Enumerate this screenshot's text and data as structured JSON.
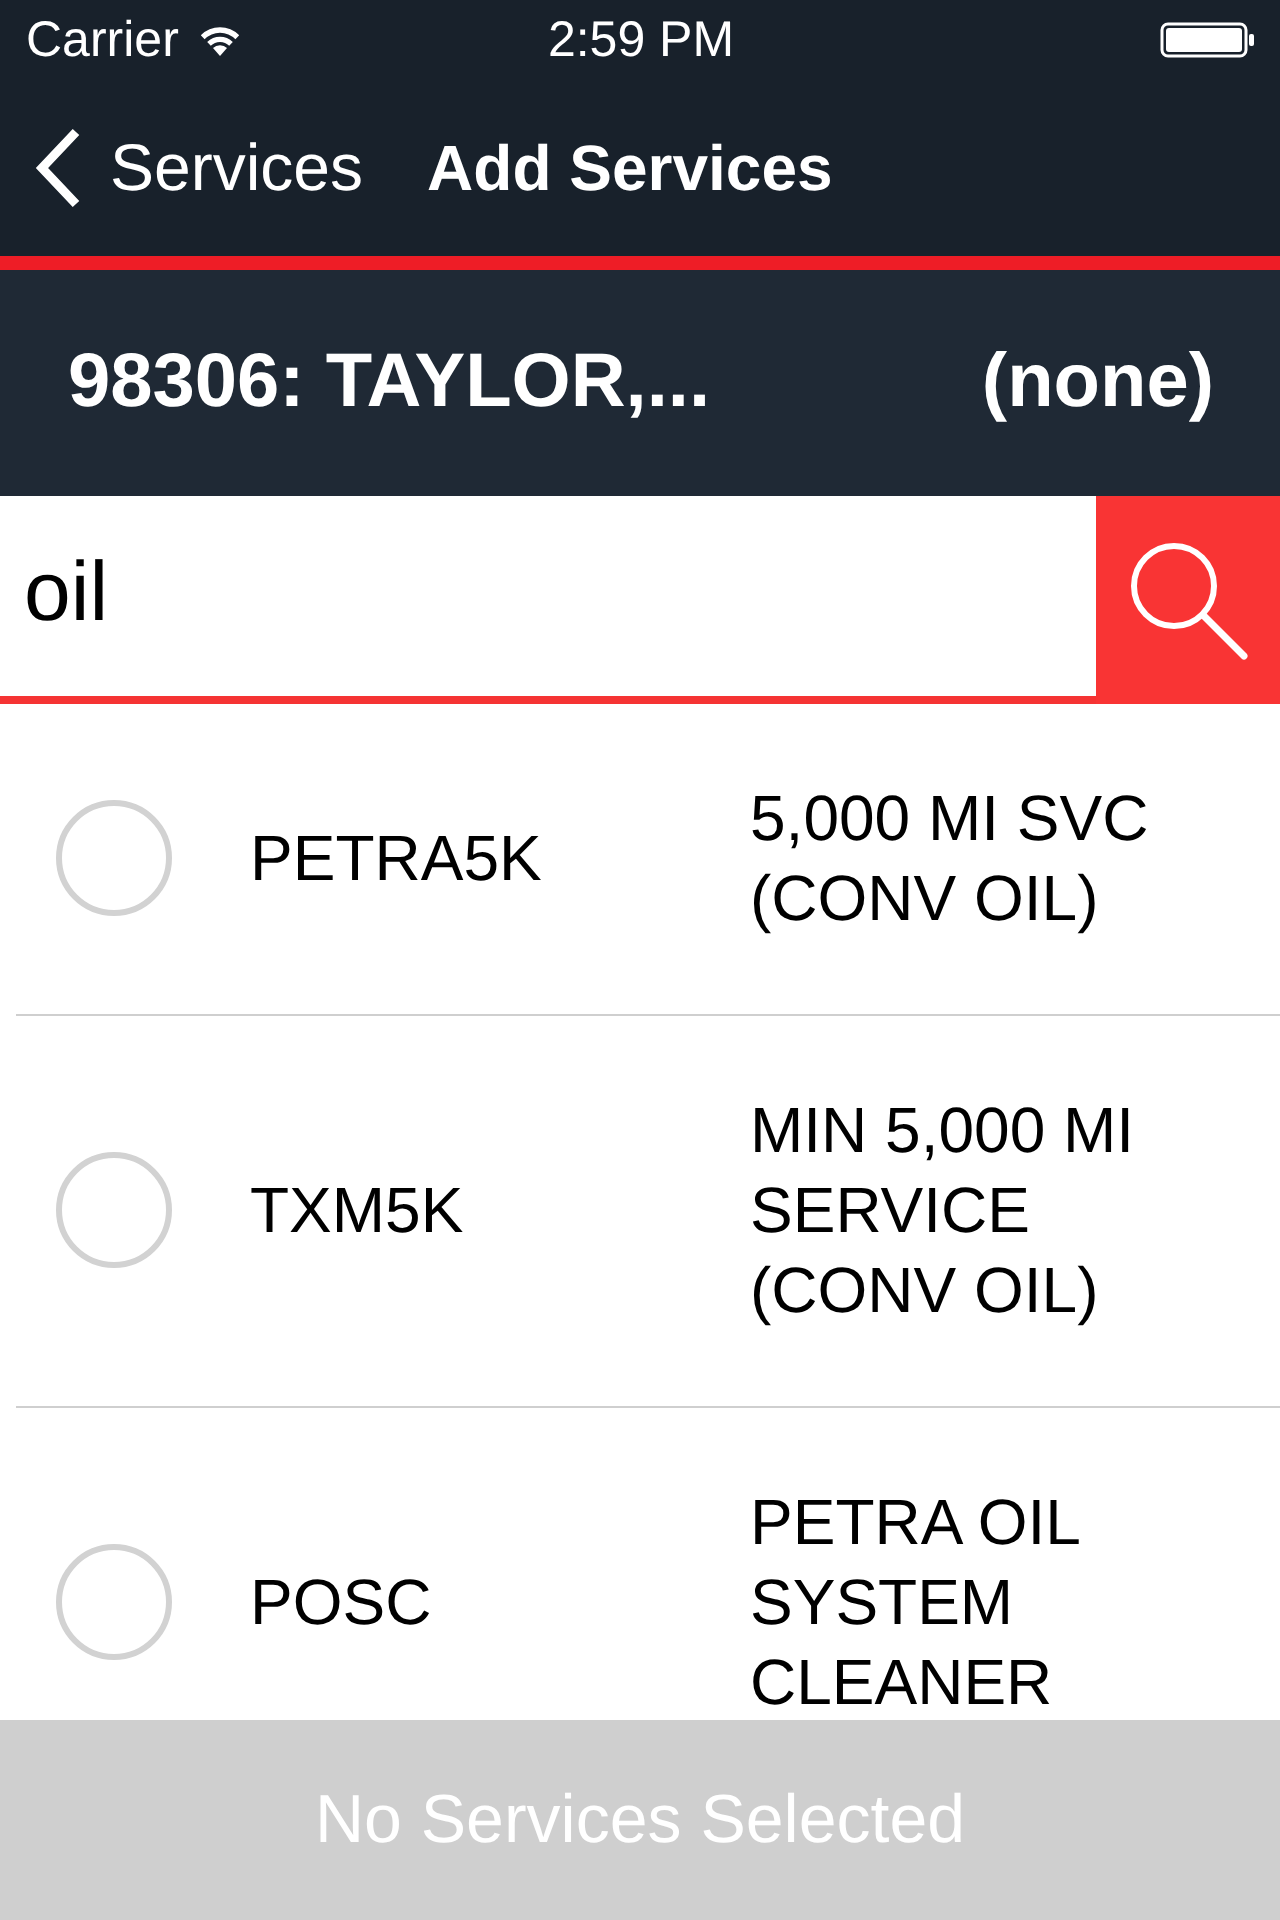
{
  "status_bar": {
    "carrier": "Carrier",
    "time": "2:59 PM"
  },
  "nav_bar": {
    "back_label": "Services",
    "title": "Add Services"
  },
  "customer_bar": {
    "customer": "98306: TAYLOR,...",
    "vehicle": "(none)"
  },
  "search": {
    "value": "oil"
  },
  "services": [
    {
      "code": "PETRA5K",
      "description": "5,000 MI SVC (CONV OIL)",
      "selected": false
    },
    {
      "code": "TXM5K",
      "description": "MIN 5,000 MI SERVICE (CONV OIL)",
      "selected": false
    },
    {
      "code": "POSC",
      "description": "PETRA OIL SYSTEM CLEANER",
      "selected": false
    }
  ],
  "footer": {
    "label": "No Services Selected",
    "enabled": false
  }
}
